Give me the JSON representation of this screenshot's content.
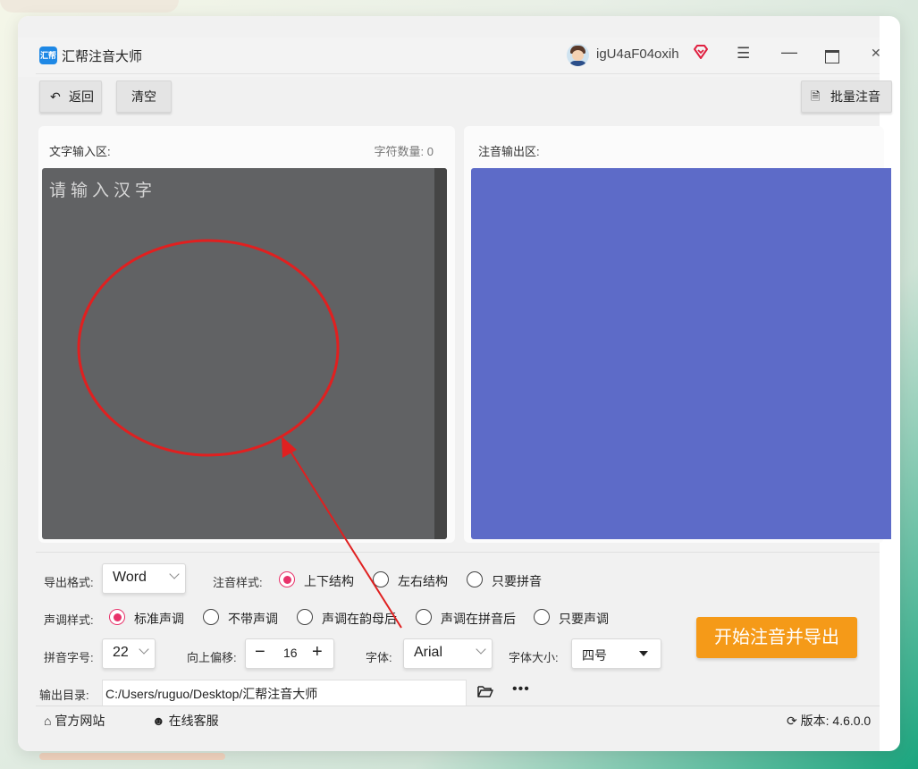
{
  "app": {
    "title": "汇帮注音大师",
    "logo_text": "汇帮",
    "username": "igU4aF04oxih"
  },
  "window_controls": {
    "menu_icon": "menu-icon",
    "minimize_icon": "minimize-icon",
    "maximize_icon": "maximize-icon",
    "close_icon": "close-icon"
  },
  "toolbar": {
    "back_label": "返回",
    "clear_label": "清空",
    "batch_label": "批量注音"
  },
  "input_panel": {
    "label": "文字输入区:",
    "char_count_label": "字符数量:",
    "char_count": "0",
    "placeholder": "请输入汉字"
  },
  "output_panel": {
    "label": "注音输出区:"
  },
  "options": {
    "export_format_label": "导出格式:",
    "export_format": "Word",
    "style_label": "注音样式:",
    "styles": [
      "上下结构",
      "左右结构",
      "只要拼音"
    ],
    "style_selected_index": 0,
    "tone_label": "声调样式:",
    "tones": [
      "标准声调",
      "不带声调",
      "声调在韵母后",
      "声调在拼音后",
      "只要声调"
    ],
    "tone_selected_index": 0,
    "pinyin_size_label": "拼音字号:",
    "pinyin_size": "22",
    "offset_label": "向上偏移:",
    "offset_value": "16",
    "font_label": "字体:",
    "font_value": "Arial",
    "font_size_label": "字体大小:",
    "font_size_value": "四号",
    "output_dir_label": "输出目录:",
    "output_dir": "C:/Users/ruguo/Desktop/汇帮注音大师",
    "start_button": "开始注音并导出"
  },
  "footer": {
    "website_label": "官方网站",
    "service_label": "在线客服",
    "version_label": "版本:",
    "version": "4.6.0.0"
  },
  "colors": {
    "input_bg": "#616264",
    "output_bg": "#5d6bc8",
    "accent_radio": "#e8336b",
    "start_button": "#f59a18",
    "annotation_red": "#e02020"
  }
}
